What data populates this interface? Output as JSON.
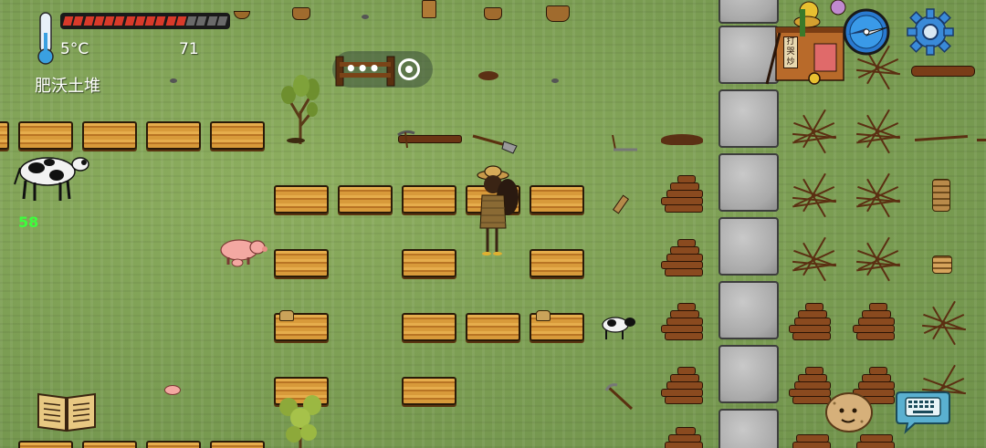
{
  "hud": {
    "temperature": "5°C",
    "food_count": "71",
    "hovered_object": "肥沃土堆",
    "health_fraction": 0.72,
    "health_segments": 16
  },
  "player": {
    "age_label": "58"
  },
  "shop": {
    "sign_text": "打\n哭\n炒"
  },
  "icons": {
    "thermometer": "thermometer-icon",
    "compass": "compass-icon",
    "settings": "gear-icon",
    "book": "book-icon",
    "chat": "keyboard-chat-icon",
    "emote": "potato-face-icon",
    "miniprogram": "more-dots-icon",
    "miniprogram_close": "target-close-icon"
  },
  "colors": {
    "grass": "#7b9d53",
    "health_fill": "#d83a2a",
    "health_empty": "#6a6a6a",
    "age_text": "#3cff3c",
    "stone": "#b0b0b0",
    "soil": "#d89a3a"
  }
}
